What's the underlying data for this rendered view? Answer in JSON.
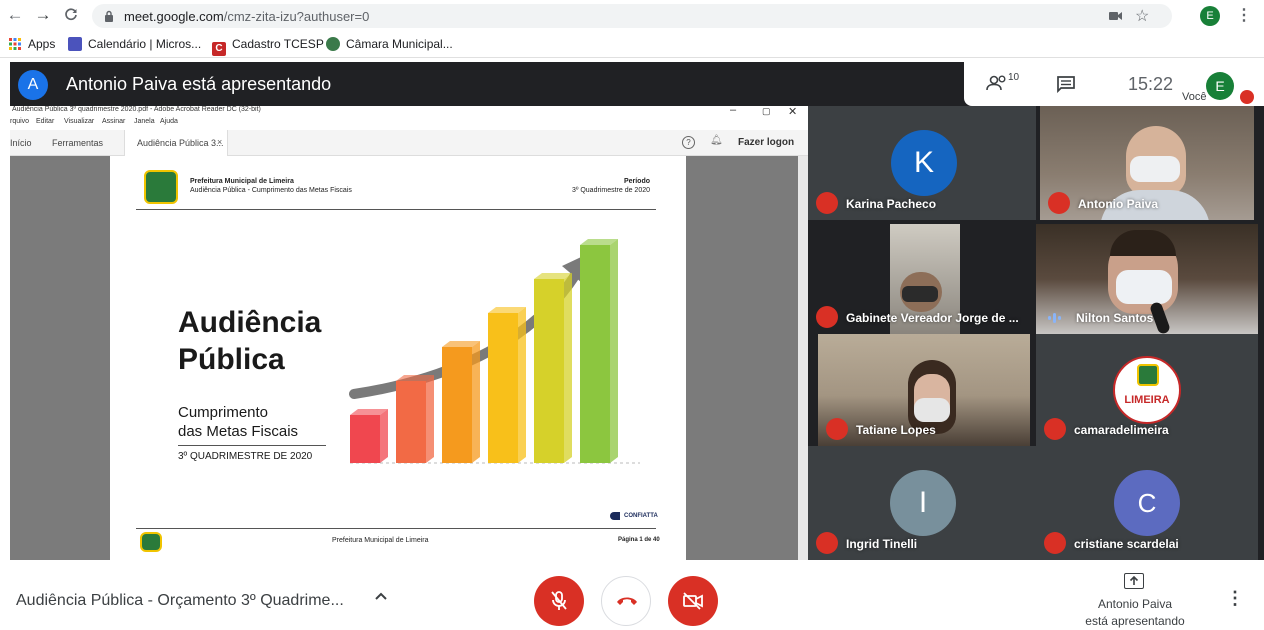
{
  "browser": {
    "url_host": "meet.google.com",
    "url_path": "/cmz-zita-izu?authuser=0",
    "profile_initial": "E",
    "bookmarks": [
      {
        "label": "Apps"
      },
      {
        "label": "Calendário | Micros..."
      },
      {
        "label": "Cadastro TCESP"
      },
      {
        "label": "Câmara Municipal..."
      }
    ]
  },
  "meet": {
    "presenter_initial": "A",
    "presenter_title": "Antonio Paiva está apresentando",
    "participants_count": "10",
    "clock": "15:22",
    "you_label": "Você",
    "you_initial": "E"
  },
  "acrobat": {
    "window_title": "Audiência Pública 3º quadrimestre 2020.pdf - Adobe Acrobat Reader DC (32-bit)",
    "menu": [
      "rquivo",
      "Editar",
      "Visualizar",
      "Assinar",
      "Janela",
      "Ajuda"
    ],
    "tabs": [
      "Início",
      "Ferramentas",
      "Audiência Pública 3..."
    ],
    "login": "Fazer logon"
  },
  "slide": {
    "header_org": "Prefeitura Municipal de Limeira",
    "header_sub": "Audiência Pública - Cumprimento das Metas Fiscais",
    "period_label": "Período",
    "period_value": "3º Quadrimestre de 2020",
    "title_line1": "Audiência",
    "title_line2": "Pública",
    "subtitle_line1": "Cumprimento",
    "subtitle_line2": "das Metas Fiscais",
    "quadrimestre": "3º QUADRIMESTRE DE 2020",
    "brand": "CONFIATTA",
    "footer_center": "Prefeitura Municipal de Limeira",
    "footer_page": "Página 1 de 40",
    "bars_colors": [
      "#f0474f",
      "#f26a45",
      "#f59a1e",
      "#f8c01a",
      "#d6d12a",
      "#8cc63f"
    ]
  },
  "participants": [
    {
      "name": "Karina Pacheco",
      "initial": "K",
      "avatar_color": "#1565c0"
    },
    {
      "name": "Antonio Paiva"
    },
    {
      "name": "Gabinete Vereador Jorge de ..."
    },
    {
      "name": "Nilton Santos"
    },
    {
      "name": "Tatiane Lopes"
    },
    {
      "name": "camaradelimeira",
      "logo_text": "LIMEIRA"
    },
    {
      "name": "Ingrid Tinelli",
      "initial": "I",
      "avatar_color": "#78909c"
    },
    {
      "name": "cristiane scardelai",
      "initial": "C",
      "avatar_color": "#5c6bc0"
    }
  ],
  "bottom": {
    "meeting_title": "Audiência Pública - Orçamento 3º Quadrime...",
    "presenting_line1": "Antonio Paiva",
    "presenting_line2": "está apresentando"
  }
}
